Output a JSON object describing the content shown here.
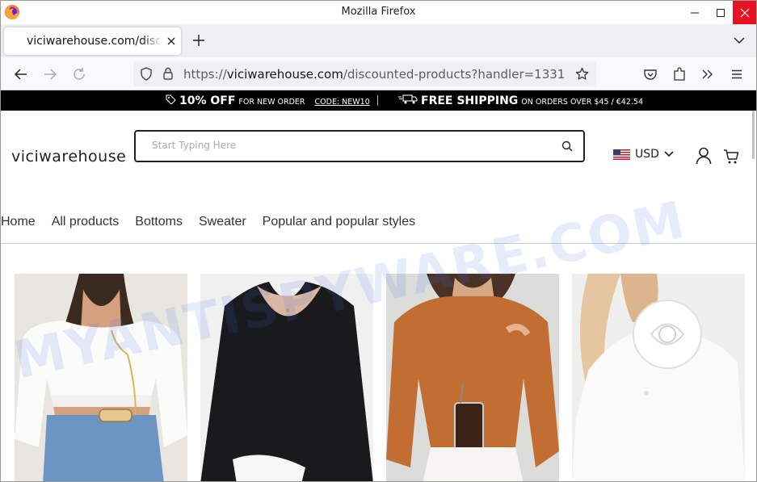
{
  "window": {
    "title": "Mozilla Firefox"
  },
  "tabs": [
    {
      "label": "viciwarehouse.com/discounted-products?handler=1331"
    }
  ],
  "navbar": {
    "url_scheme": "https://",
    "url_host": "viciwarehouse.com",
    "url_path": "/discounted-products?handler=1331"
  },
  "promo": {
    "discount_big": "10% OFF",
    "discount_small": "FOR NEW ORDER",
    "discount_code": "CODE: NEW10",
    "shipping_big": "FREE SHIPPING",
    "shipping_small": "ON ORDERS OVER $45 / €42.54"
  },
  "header": {
    "logo": "viciwarehouse",
    "search_placeholder": "Start Typing Here",
    "currency": "USD"
  },
  "menu": [
    {
      "label": "Home"
    },
    {
      "label": "All products"
    },
    {
      "label": "Bottoms"
    },
    {
      "label": "Sweater"
    },
    {
      "label": "Popular and popular styles"
    }
  ],
  "products": [
    {
      "image": "white-off-shoulder-blouse",
      "color": "#ecebe8"
    },
    {
      "image": "black-scoop-neck-top",
      "color": "#1c1c1e"
    },
    {
      "image": "orange-turtleneck-top",
      "color": "#c97a40"
    },
    {
      "image": "white-rose-blouse",
      "color": "#f2f2f2"
    }
  ],
  "watermark": "MYANTISPYWARE.COM",
  "colors": {
    "accent": "#e81123",
    "promo_bg": "#000000",
    "text": "#222222"
  }
}
